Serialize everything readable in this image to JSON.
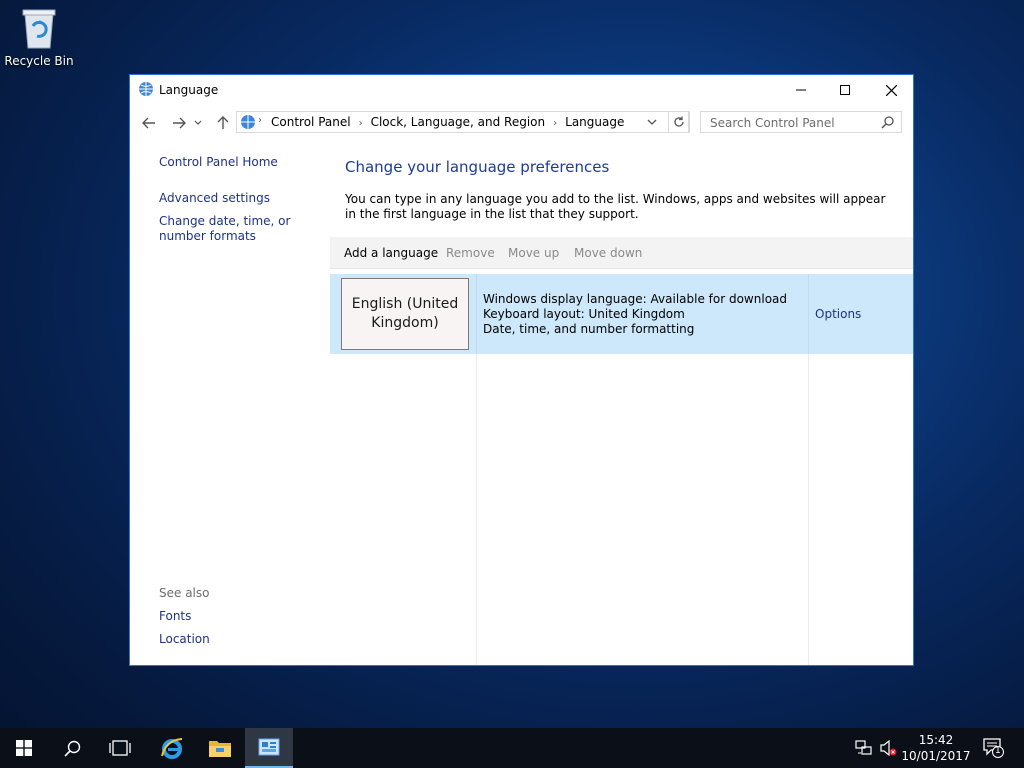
{
  "desktop": {
    "recycle_bin_label": "Recycle Bin"
  },
  "window": {
    "title": "Language",
    "minimize_icon": "minimize-icon",
    "maximize_icon": "maximize-icon",
    "close_icon": "close-icon"
  },
  "address_bar": {
    "breadcrumbs": [
      "Control Panel",
      "Clock, Language, and Region",
      "Language"
    ],
    "search_placeholder": "Search Control Panel"
  },
  "left_pane": {
    "home_link": "Control Panel Home",
    "links": [
      "Advanced settings",
      "Change date, time, or number formats"
    ],
    "see_also_label": "See also",
    "see_also_links": [
      "Fonts",
      "Location"
    ]
  },
  "main": {
    "heading": "Change your language preferences",
    "description": "You can type in any language you add to the list. Windows, apps and websites will appear in the first language in the list that they support.",
    "toolbar": {
      "add": "Add a language",
      "remove": "Remove",
      "move_up": "Move up",
      "move_down": "Move down"
    },
    "languages": [
      {
        "name": "English (United Kingdom)",
        "details": [
          "Windows display language: Available for download",
          "Keyboard layout: United Kingdom",
          "Date, time, and number formatting"
        ],
        "options_label": "Options"
      }
    ]
  },
  "taskbar": {
    "time": "15:42",
    "date": "10/01/2017",
    "notification_count": "1"
  },
  "colors": {
    "link": "#1e3287",
    "heading": "#1e3b95",
    "selected_row": "#cde8fb",
    "window_border": "#2b74d8",
    "taskbar": "#0b0f17"
  }
}
